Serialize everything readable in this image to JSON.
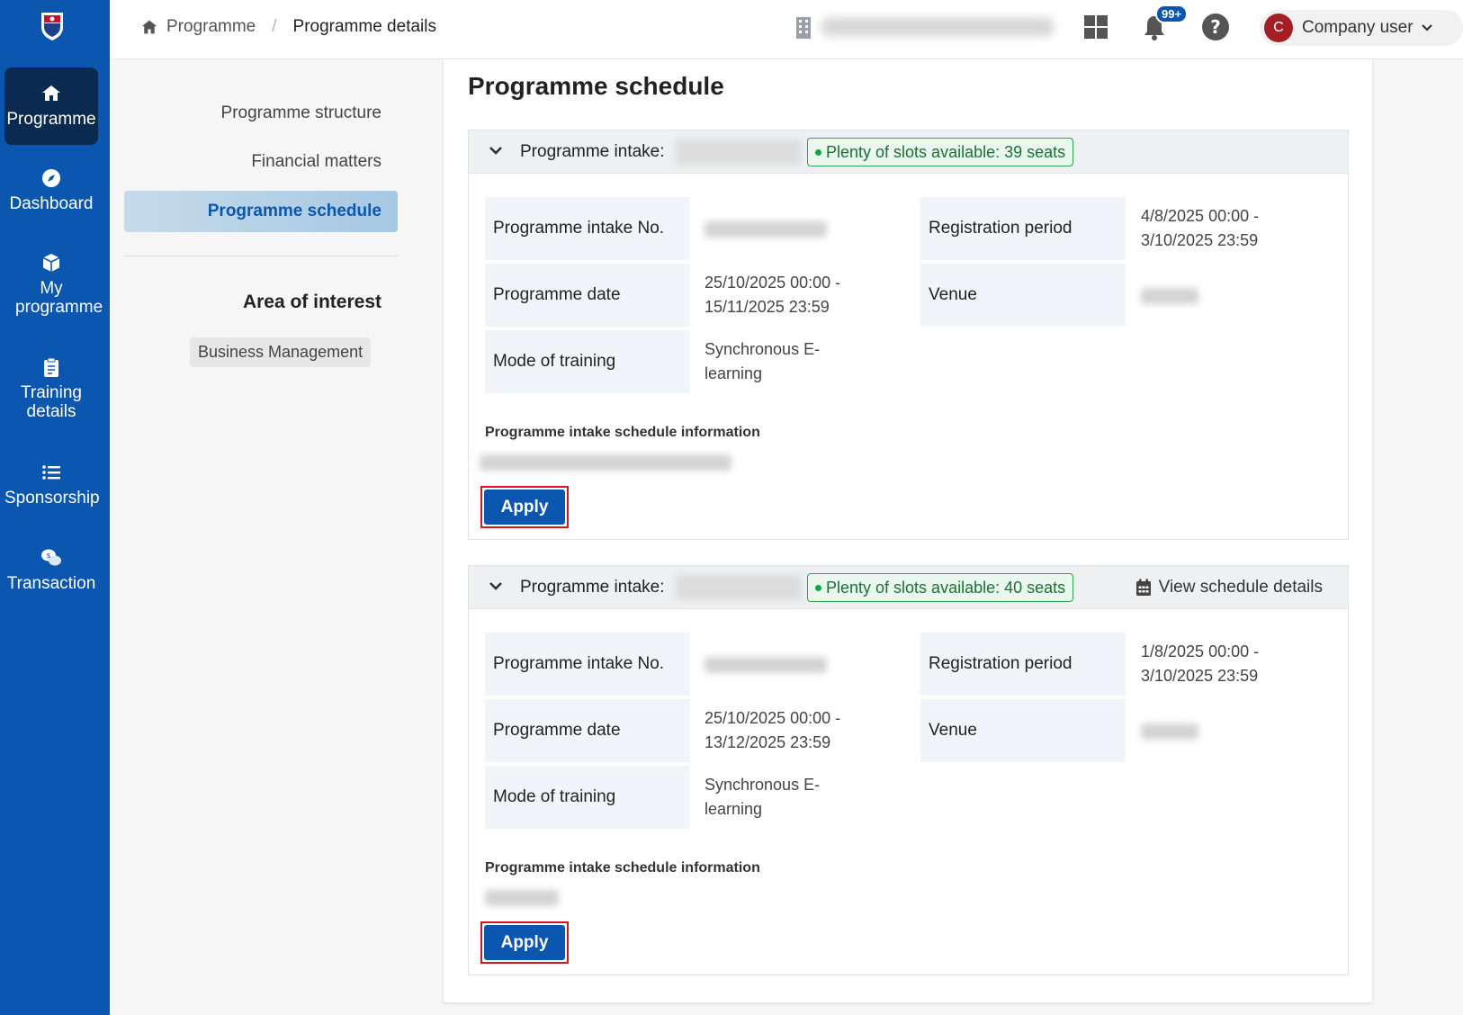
{
  "sidebar": {
    "items": [
      {
        "label": "Programme",
        "icon": "home-icon",
        "active": true
      },
      {
        "label": "Dashboard",
        "icon": "compass-icon"
      },
      {
        "label": "My programme",
        "icon": "box-icon"
      },
      {
        "label": "Training details",
        "icon": "clipboard-icon"
      },
      {
        "label": "Sponsorship",
        "icon": "list-icon"
      },
      {
        "label": "Transaction",
        "icon": "chat-dollar-icon"
      }
    ]
  },
  "header": {
    "breadcrumb_root": "Programme",
    "breadcrumb_separator": "/",
    "breadcrumb_current": "Programme details",
    "notifications_badge": "99+",
    "user_initial": "C",
    "user_name": "Company user"
  },
  "section_nav": {
    "items": [
      "Programme structure",
      "Financial matters",
      "Programme schedule"
    ],
    "area_of_interest_title": "Area of interest",
    "area_of_interest_tag": "Business Management"
  },
  "schedule": {
    "title": "Programme schedule",
    "intakes": [
      {
        "label": "Programme intake:",
        "slots": "Plenty of slots available: 39 seats",
        "fields": {
          "intake_no_label": "Programme intake No.",
          "registration_label": "Registration period",
          "registration_value": "4/8/2025 00:00 - 3/10/2025 23:59",
          "date_label": "Programme date",
          "date_value": "25/10/2025 00:00 - 15/11/2025 23:59",
          "venue_label": "Venue",
          "mode_label": "Mode of training",
          "mode_value": "Synchronous E-learning"
        },
        "schedule_info_label": "Programme intake schedule information",
        "apply_label": "Apply"
      },
      {
        "label": "Programme intake:",
        "slots": "Plenty of slots available: 40 seats",
        "view_schedule": "View schedule details",
        "fields": {
          "intake_no_label": "Programme intake No.",
          "registration_label": "Registration period",
          "registration_value": "1/8/2025 00:00 - 3/10/2025 23:59",
          "date_label": "Programme date",
          "date_value": "25/10/2025 00:00 - 13/12/2025 23:59",
          "venue_label": "Venue",
          "mode_label": "Mode of training",
          "mode_value": "Synchronous E-learning"
        },
        "schedule_info_label": "Programme intake schedule information",
        "apply_label": "Apply"
      }
    ]
  },
  "colors": {
    "sidebar": "#0b57b0",
    "sidebar_active": "#0a2a4f",
    "primary": "#0b57b0",
    "slots_green": "#2ea44f",
    "apply_outline": "#d6141b"
  }
}
